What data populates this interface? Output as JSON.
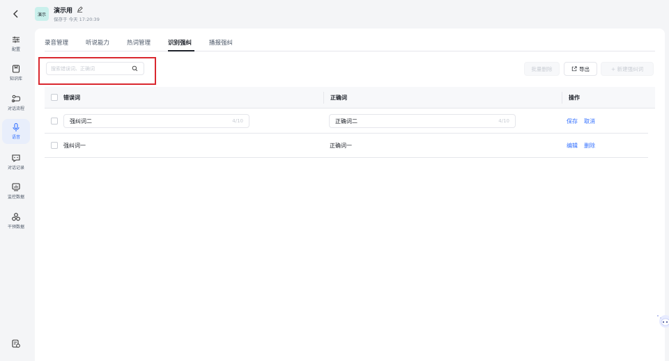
{
  "sidebar": {
    "items": [
      {
        "label": "配置",
        "icon": "sliders-icon"
      },
      {
        "label": "知识库",
        "icon": "book-icon"
      },
      {
        "label": "对话流程",
        "icon": "flow-icon"
      },
      {
        "label": "语音",
        "icon": "microphone-icon",
        "active": true
      },
      {
        "label": "对话记录",
        "icon": "chat-icon"
      },
      {
        "label": "监控数据",
        "icon": "monitor-icon"
      },
      {
        "label": "干预数据",
        "icon": "cluster-icon"
      }
    ]
  },
  "header": {
    "avatar_text": "演示",
    "title": "演示用",
    "subtitle": "保存于 今天 17:20:39"
  },
  "tabs": [
    {
      "label": "录音管理"
    },
    {
      "label": "听说能力"
    },
    {
      "label": "热词管理"
    },
    {
      "label": "识别强纠",
      "active": true
    },
    {
      "label": "播报强纠"
    }
  ],
  "toolbar": {
    "search_placeholder": "搜索错误词、正确词",
    "bulk_delete_label": "批量删除",
    "export_label": "导出",
    "new_label": "+ 新建强纠词"
  },
  "table": {
    "headers": {
      "wrong": "错误词",
      "correct": "正确词",
      "actions": "操作"
    },
    "rows": [
      {
        "wrong": "强纠词二",
        "wrong_count": "4/10",
        "correct": "正确词二",
        "correct_count": "4/10",
        "action1": "保存",
        "action2": "取消",
        "editing": true
      },
      {
        "wrong": "强纠词一",
        "correct": "正确词一",
        "action1": "编辑",
        "action2": "删除",
        "editing": false
      }
    ]
  },
  "colors": {
    "accent": "#3370ff",
    "highlight": "#d9272e",
    "avatar_bg": "#c9f0ec"
  }
}
